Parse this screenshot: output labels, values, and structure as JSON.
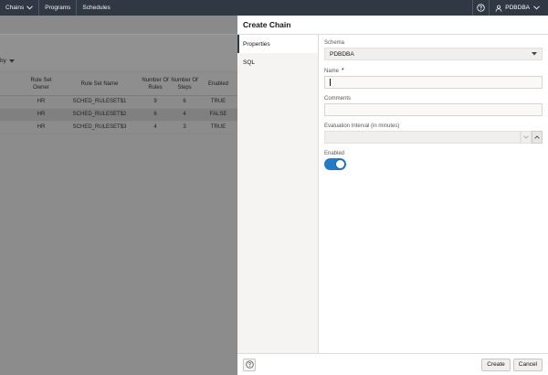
{
  "topbar": {
    "nav": [
      {
        "label": "Chains",
        "has_menu": true
      },
      {
        "label": "Programs",
        "has_menu": false
      },
      {
        "label": "Schedules",
        "has_menu": false
      }
    ],
    "user": "PDBDBA"
  },
  "background": {
    "sort_label": "by",
    "table": {
      "headers": [
        "Rule Set Owner",
        "Rule Set Name",
        "Number Of Rules",
        "Number Of Steps",
        "Enabled"
      ],
      "rows": [
        {
          "owner": "HR",
          "name": "SCHED_RULESET$1",
          "rules": "9",
          "steps": "6",
          "enabled": "TRUE"
        },
        {
          "owner": "HR",
          "name": "SCHED_RULESET$2",
          "rules": "6",
          "steps": "4",
          "enabled": "FALSE"
        },
        {
          "owner": "HR",
          "name": "SCHED_RULESET$3",
          "rules": "4",
          "steps": "3",
          "enabled": "TRUE"
        }
      ]
    }
  },
  "drawer": {
    "title": "Create Chain",
    "nav": [
      "Properties",
      "SQL"
    ],
    "form": {
      "schema_label": "Schema",
      "schema_value": "PDBDBA",
      "name_label": "Name",
      "name_required_mark": "*",
      "name_value": "",
      "comments_label": "Comments",
      "comments_value": "",
      "interval_label": "Evaluation Interval (in minutes)",
      "interval_value": "",
      "enabled_label": "Enabled",
      "enabled": true
    },
    "footer": {
      "create_label": "Create",
      "cancel_label": "Cancel"
    }
  },
  "icons": {
    "help": "help-circle-icon",
    "user": "user-icon",
    "chevron": "chevron-down-icon"
  }
}
